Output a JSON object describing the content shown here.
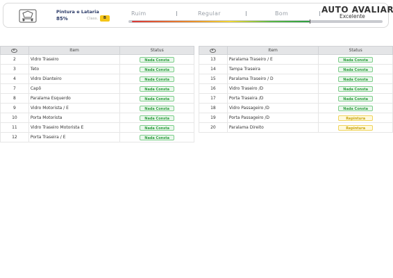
{
  "header": {
    "category": "Pintura e Lataria",
    "percent": "85%",
    "class_label": "Class.",
    "class_value": "B",
    "scale": [
      "Ruim",
      "Regular",
      "Bom"
    ],
    "score_fraction": 0.71,
    "brand": "AUTO AVALIAR",
    "brand_sub": "Excelente"
  },
  "columns": {
    "icon": "eye-icon",
    "item": "Item",
    "status": "Status"
  },
  "left_rows": [
    {
      "num": "2",
      "item": "Vidro Traseiro",
      "status": "Nada Consta",
      "type": "ok"
    },
    {
      "num": "3",
      "item": "Teto",
      "status": "Nada Consta",
      "type": "ok"
    },
    {
      "num": "4",
      "item": "Vidro Dianteiro",
      "status": "Nada Consta",
      "type": "ok"
    },
    {
      "num": "7",
      "item": "Capô",
      "status": "Nada Consta",
      "type": "ok"
    },
    {
      "num": "8",
      "item": "Paralama Esquerdo",
      "status": "Nada Consta",
      "type": "ok"
    },
    {
      "num": "9",
      "item": "Vidro Motorista / E",
      "status": "Nada Consta",
      "type": "ok"
    },
    {
      "num": "10",
      "item": "Porta Motorista",
      "status": "Nada Consta",
      "type": "ok"
    },
    {
      "num": "11",
      "item": "Vidro Traseiro Motorista E",
      "status": "Nada Consta",
      "type": "ok"
    },
    {
      "num": "12",
      "item": "Porta Traseira / E",
      "status": "Nada Consta",
      "type": "ok"
    }
  ],
  "right_rows": [
    {
      "num": "13",
      "item": "Paralama Traseiro / E",
      "status": "Nada Consta",
      "type": "ok"
    },
    {
      "num": "14",
      "item": "Tampa Traseira",
      "status": "Nada Consta",
      "type": "ok"
    },
    {
      "num": "15",
      "item": "Paralama Traseiro / D",
      "status": "Nada Consta",
      "type": "ok"
    },
    {
      "num": "16",
      "item": "Vidro Traseiro /D",
      "status": "Nada Consta",
      "type": "ok"
    },
    {
      "num": "17",
      "item": "Porta Traseira /D",
      "status": "Nada Consta",
      "type": "ok"
    },
    {
      "num": "18",
      "item": "Vidro Passageiro /D",
      "status": "Nada Consta",
      "type": "ok"
    },
    {
      "num": "19",
      "item": "Porta Passageiro /D",
      "status": "Repintura",
      "type": "reg"
    },
    {
      "num": "20",
      "item": "Paralama Direito",
      "status": "Repintura",
      "type": "reg"
    }
  ]
}
